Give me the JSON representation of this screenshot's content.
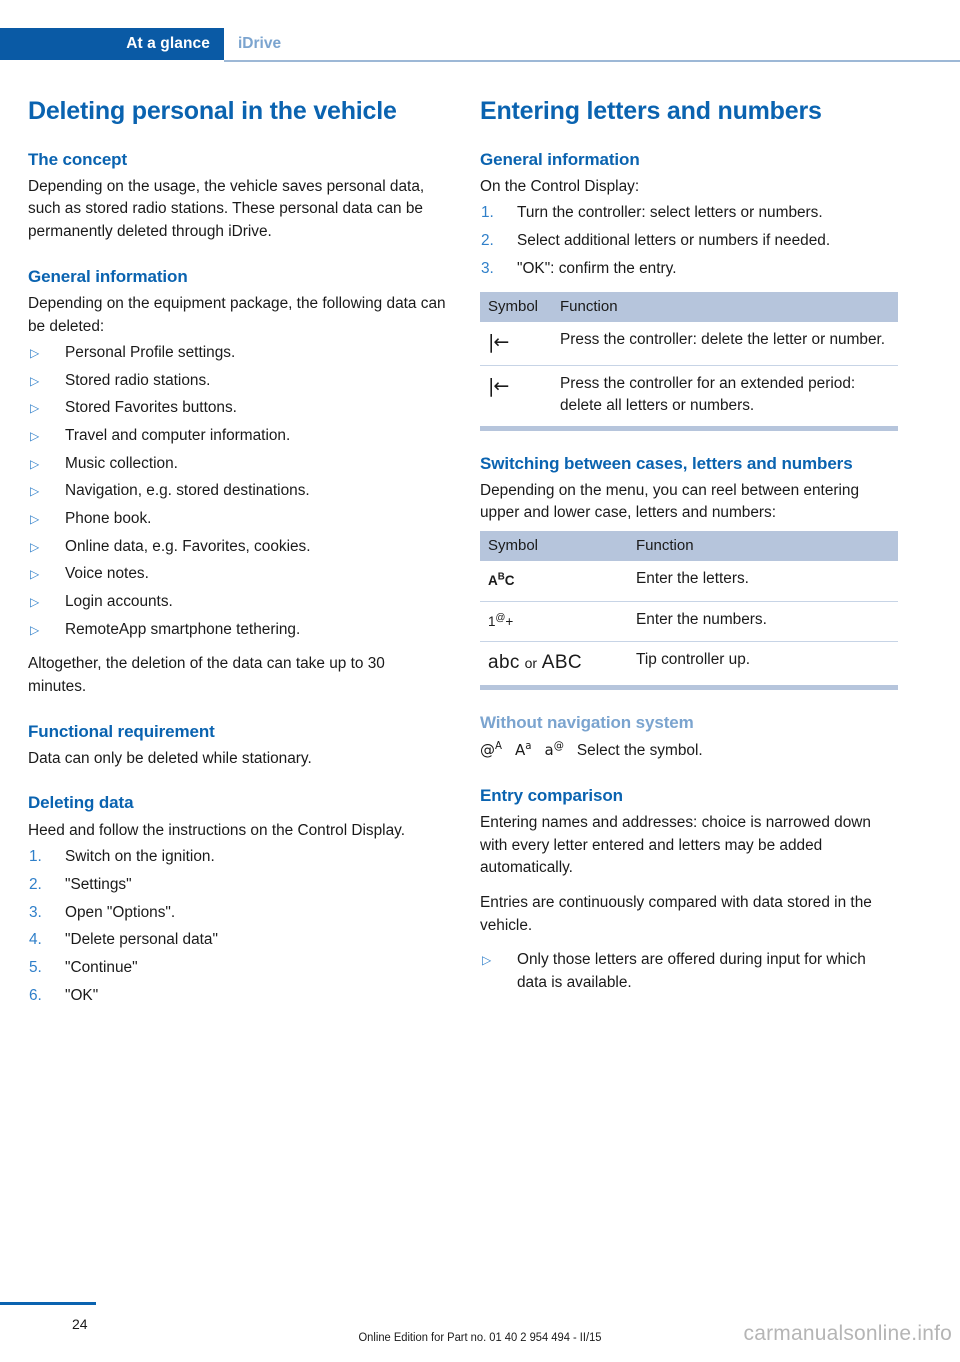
{
  "header": {
    "tab_active": "At a glance",
    "tab_section": "iDrive"
  },
  "left_column": {
    "title": "Deleting personal in the vehicle",
    "concept": {
      "heading": "The concept",
      "body": "Depending on the usage, the vehicle saves personal data, such as stored radio stations. These personal data can be permanently deleted through iDrive."
    },
    "general_information": {
      "heading": "General information",
      "intro": "Depending on the equipment package, the following data can be deleted:",
      "bullets": [
        "Personal Profile settings.",
        "Stored radio stations.",
        "Stored Favorites buttons.",
        "Travel and computer information.",
        "Music collection.",
        "Navigation, e.g. stored destinations.",
        "Phone book.",
        "Online data, e.g. Favorites, cookies.",
        "Voice notes.",
        "Login accounts.",
        "RemoteApp smartphone tethering."
      ],
      "outro": "Altogether, the deletion of the data can take up to 30 minutes."
    },
    "functional_requirement": {
      "heading": "Functional requirement",
      "body": "Data can only be deleted while stationary."
    },
    "deleting_data": {
      "heading": "Deleting data",
      "intro": "Heed and follow the instructions on the Control Display.",
      "steps": [
        {
          "number": "1.",
          "text": "Switch on the ignition."
        },
        {
          "number": "2.",
          "text": "\"Settings\""
        },
        {
          "number": "3.",
          "text": "Open \"Options\"."
        },
        {
          "number": "4.",
          "text": "\"Delete personal data\""
        },
        {
          "number": "5.",
          "text": "\"Continue\""
        },
        {
          "number": "6.",
          "text": "\"OK\""
        }
      ]
    }
  },
  "right_column": {
    "title": "Entering letters and numbers",
    "general_information": {
      "heading": "General information",
      "intro": "On the Control Display:",
      "steps": [
        {
          "number": "1.",
          "text": "Turn the controller: select letters or numbers."
        },
        {
          "number": "2.",
          "text": "Select additional letters or numbers if needed."
        },
        {
          "number": "3.",
          "text": "\"OK\": confirm the entry."
        }
      ]
    },
    "table_delete": {
      "columns": [
        "Symbol",
        "Function"
      ],
      "rows": [
        {
          "symbol": "backspace-icon",
          "function": "Press the controller: delete the letter or number."
        },
        {
          "symbol": "backspace-icon",
          "function": "Press the controller for an extended period: delete all letters or numbers."
        }
      ]
    },
    "switching": {
      "heading": "Switching between cases, letters and numbers",
      "body": "Depending on the menu, you can reel between entering upper and lower case, letters and numbers:"
    },
    "table_cases": {
      "columns": [
        "Symbol",
        "Function"
      ],
      "rows": [
        {
          "symbol": "ABC-letters-icon",
          "function": "Enter the letters."
        },
        {
          "symbol": "1-at-plus-numbers-icon",
          "function": "Enter the numbers."
        },
        {
          "symbol": "abc-or-ABC-icon",
          "function": "Tip controller up."
        }
      ]
    },
    "without_navigation": {
      "heading": "Without navigation system",
      "symbols": [
        "at-superscript-A-icon",
        "A-superscript-a-icon",
        "a-superscript-at-icon"
      ],
      "text": "Select the symbol."
    },
    "entry_comparison": {
      "heading": "Entry comparison",
      "para1": "Entering names and addresses: choice is narrowed down with every letter entered and letters may be added automatically.",
      "para2": "Entries are continuously compared with data stored in the vehicle.",
      "bullets": [
        "Only those letters are offered during input for which data is available."
      ]
    }
  },
  "footer": {
    "page_number": "24",
    "note": "Online Edition for Part no. 01 40 2 954 494 - II/15",
    "watermark": "carmanualsonline.info"
  },
  "colors": {
    "brand_blue": "#0a5aa5",
    "heading_blue": "#0a63b0",
    "light_blue": "#7ba4cf",
    "table_header": "#b6c5dc",
    "marker_blue": "#2f7fc9"
  }
}
